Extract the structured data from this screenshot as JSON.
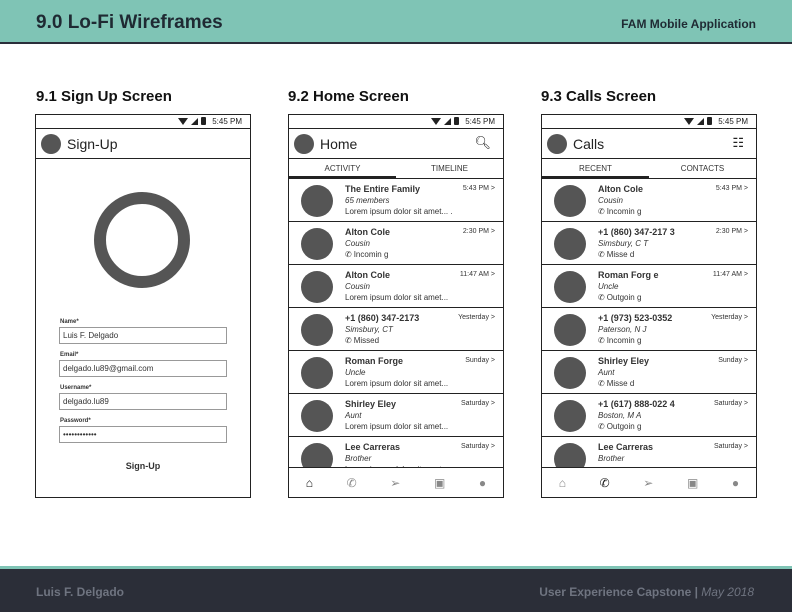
{
  "header": {
    "title": "9.0 Lo-Fi Wireframes",
    "app_name": "FAM Mobile Application"
  },
  "footer": {
    "author": "Luis F. Delgado",
    "course": "User Experience Capstone |",
    "date": "May 2018"
  },
  "status_time": "5:45 PM",
  "signup": {
    "section_title": "9.1 Sign Up Screen",
    "app_title": "Sign-Up",
    "fields": [
      {
        "label": "Name*",
        "value": "Luis F. Delgado"
      },
      {
        "label": "Email*",
        "value": "delgado.lu89@gmail.com"
      },
      {
        "label": "Username*",
        "value": "delgado.lu89"
      },
      {
        "label": "Password*",
        "value": "••••••••••••"
      }
    ],
    "button": "Sign-Up"
  },
  "home": {
    "section_title": "9.2 Home Screen",
    "app_title": "Home",
    "tabs": [
      "ACTIVITY",
      "TIMELINE"
    ],
    "rows": [
      {
        "name": "The Entire Family",
        "sub": "65 members",
        "line": "Lorem ipsum dolor sit amet... .",
        "time": "5:43 PM >",
        "call": false
      },
      {
        "name": "Alton Cole",
        "sub": "Cousin",
        "line": "Incomin g",
        "time": "2:30 PM >",
        "call": true
      },
      {
        "name": "Alton Cole",
        "sub": "Cousin",
        "line": "Lorem ipsum dolor sit amet...",
        "time": "11:47 AM >",
        "call": false
      },
      {
        "name": "+1 (860) 347-2173",
        "sub": "Simsbury, CT",
        "line": "Missed",
        "time": "Yesterday >",
        "call": true
      },
      {
        "name": "Roman Forge",
        "sub": "Uncle",
        "line": "Lorem ipsum dolor sit amet...",
        "time": "Sunday >",
        "call": false
      },
      {
        "name": "Shirley Eley",
        "sub": "Aunt",
        "line": "Lorem ipsum dolor sit amet...",
        "time": "Saturday >",
        "call": false
      },
      {
        "name": "Lee Carreras",
        "sub": "Brother",
        "line": "Lorem ipsum dolor sit amet...",
        "time": "Saturday >",
        "call": false
      }
    ]
  },
  "calls": {
    "section_title": "9.3 Calls Screen",
    "app_title": "Calls",
    "tabs": [
      "RECENT",
      "CONTACTS"
    ],
    "rows": [
      {
        "name": "Alton Cole",
        "sub": "Cousin",
        "line": "Incomin g",
        "time": "5:43 PM >"
      },
      {
        "name": "+1 (860) 347-217 3",
        "sub": "Simsbury, C T",
        "line": "Misse d",
        "time": "2:30 PM >"
      },
      {
        "name": "Roman Forg e",
        "sub": "Uncle",
        "line": "Outgoin g",
        "time": "11:47 AM >"
      },
      {
        "name": "+1 (973) 523-0352",
        "sub": "Paterson, N J",
        "line": "Incomin g",
        "time": "Yesterday >"
      },
      {
        "name": "Shirley Eley",
        "sub": "Aunt",
        "line": "Misse d",
        "time": "Sunday >"
      },
      {
        "name": "+1 (617) 888-022 4",
        "sub": "Boston, M A",
        "line": "Outgoin g",
        "time": "Saturday >"
      },
      {
        "name": "Lee Carreras",
        "sub": "Brother",
        "line": "",
        "time": "Saturday >"
      }
    ]
  }
}
